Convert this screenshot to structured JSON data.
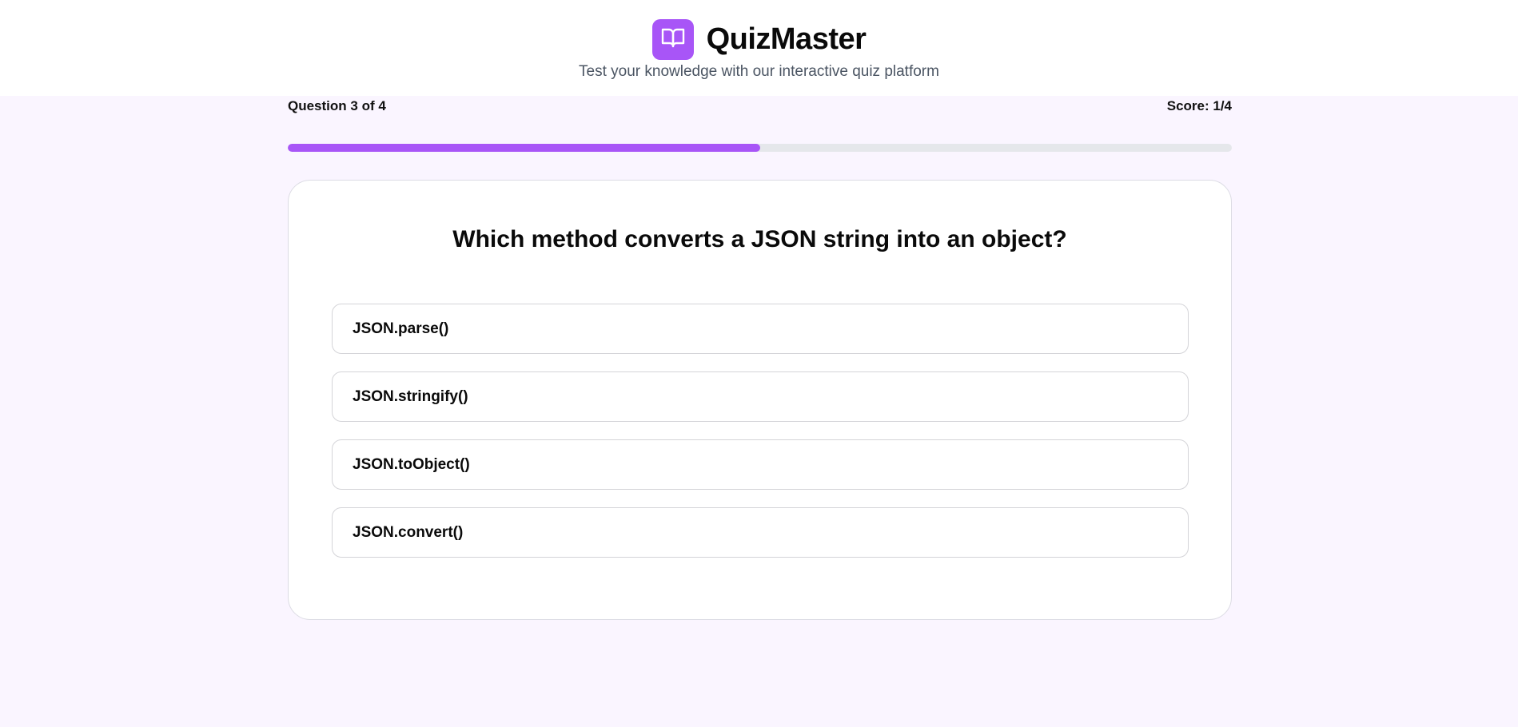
{
  "header": {
    "title": "QuizMaster",
    "tagline": "Test your knowledge with our interactive quiz platform",
    "logo_icon": "open-book-icon"
  },
  "progress": {
    "question_label": "Question 3 of 4",
    "score_label": "Score: 1/4",
    "fraction": 0.5
  },
  "quiz": {
    "question": "Which method converts a JSON string into an object?",
    "options": [
      {
        "label": "JSON.parse()"
      },
      {
        "label": "JSON.stringify()"
      },
      {
        "label": "JSON.toObject()"
      },
      {
        "label": "JSON.convert()"
      }
    ]
  },
  "colors": {
    "accent": "#a855f7",
    "page_bg": "#faf5ff",
    "track": "#e5e7eb"
  }
}
